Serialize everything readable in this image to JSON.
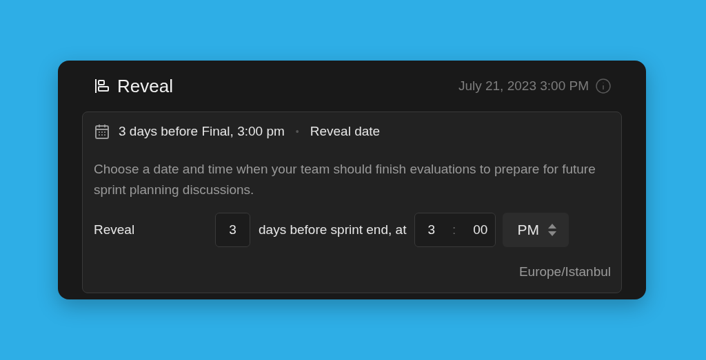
{
  "header": {
    "title": "Reveal",
    "datetime": "July 21, 2023 3:00 PM"
  },
  "summary": {
    "schedule": "3 days before Final, 3:00 pm",
    "separator": "•",
    "label": "Reveal date"
  },
  "description": "Choose a date and time when your team should finish evaluations to prepare for future sprint planning discussions.",
  "setting": {
    "label": "Reveal",
    "days": "3",
    "middle_text": "days before sprint end, at",
    "hour": "3",
    "colon": ":",
    "minute": "00",
    "period": "PM"
  },
  "timezone": "Europe/Istanbul"
}
